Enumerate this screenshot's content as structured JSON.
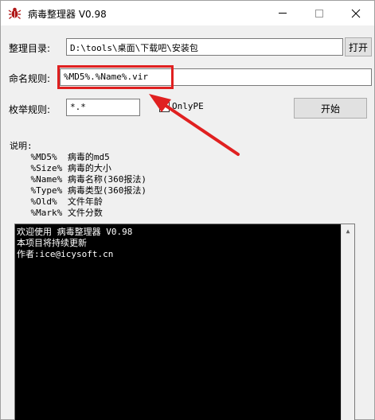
{
  "window": {
    "title": "病毒整理器 V0.98"
  },
  "form": {
    "dir_label": "整理目录:",
    "dir_value": "D:\\tools\\桌面\\下载吧\\安装包",
    "open_button": "打开",
    "name_label": "命名规则:",
    "name_value": "%MD5%.%Name%.vir",
    "enum_label": "枚举规则:",
    "enum_value": "*.*",
    "onlype_label": "OnlyPE",
    "onlype_checked": false,
    "start_button": "开始"
  },
  "notes": {
    "heading": "说明:",
    "lines": [
      "    %MD5%  病毒的md5",
      "    %Size% 病毒的大小",
      "    %Name% 病毒名称(360报法)",
      "    %Type% 病毒类型(360报法)",
      "    %Old%  文件年龄",
      "    %Mark% 文件分数"
    ]
  },
  "console": {
    "lines": [
      "欢迎使用 病毒整理器 V0.98",
      "本项目将持续更新",
      "作者:ice@icysoft.cn"
    ]
  },
  "colors": {
    "highlight": "#e02020",
    "arrow": "#e02020",
    "console_bg": "#000000",
    "console_text": "#ffffff"
  }
}
